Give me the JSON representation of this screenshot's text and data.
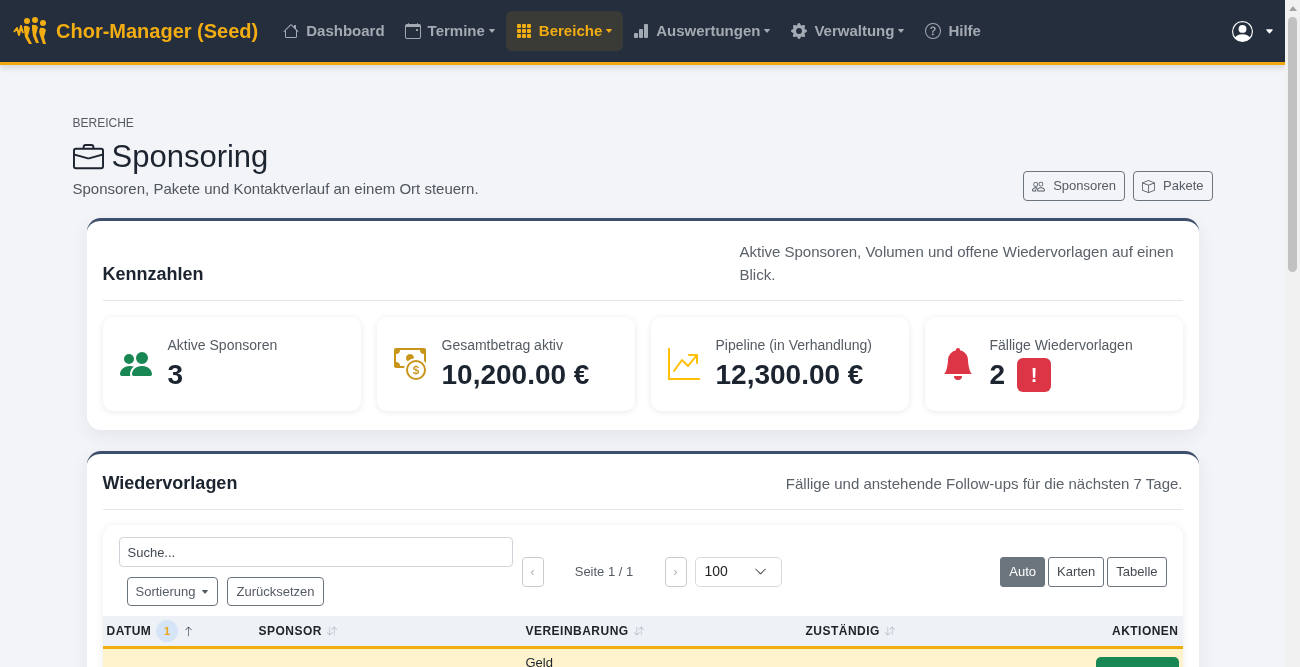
{
  "navbar": {
    "brand": "Chor-Manager (Seed)",
    "items": [
      {
        "label": "Dashboard",
        "has_menu": false,
        "selected": false
      },
      {
        "label": "Termine",
        "has_menu": true,
        "selected": false
      },
      {
        "label": "Bereiche",
        "has_menu": true,
        "selected": true
      },
      {
        "label": "Auswertungen",
        "has_menu": true,
        "selected": false
      },
      {
        "label": "Verwaltung",
        "has_menu": true,
        "selected": false
      },
      {
        "label": "Hilfe",
        "has_menu": false,
        "selected": false
      }
    ]
  },
  "header": {
    "breadcrumb": "BEREICHE",
    "title": "Sponsoring",
    "subtitle": "Sponsoren, Pakete und Kontaktverlauf an einem Ort steuern.",
    "actions": [
      "Sponsoren",
      "Pakete"
    ]
  },
  "kennzahlen": {
    "title": "Kennzahlen",
    "description": "Aktive Sponsoren, Volumen und offene Wiedervorlagen auf einen Blick.",
    "stats": [
      {
        "label": "Aktive Sponsoren",
        "value": "3",
        "color": "#198754"
      },
      {
        "label": "Gesamtbetrag aktiv",
        "value": "10,200.00 €",
        "color": "#c8951a"
      },
      {
        "label": "Pipeline (in Verhandlung)",
        "value": "12,300.00 €",
        "color": "#ffc107"
      },
      {
        "label": "Fällige Wiedervorlagen",
        "value": "2",
        "color": "#dc3545",
        "badge": "!"
      }
    ]
  },
  "wiedervorlagen": {
    "title": "Wiedervorlagen",
    "description": "Fällige und anstehende Follow-ups für die nächsten 7 Tage.",
    "search": {
      "placeholder": "Suche..."
    },
    "sort_button": "Sortierung",
    "reset_button": "Zurücksetzen",
    "pager": {
      "prev": {
        "label": "‹",
        "disabled": true
      },
      "label": "Seite 1 / 1",
      "next": {
        "label": "›",
        "disabled": true
      }
    },
    "page_size": "100",
    "views": [
      {
        "label": "Auto",
        "selected": true
      },
      {
        "label": "Karten",
        "selected": false
      },
      {
        "label": "Tabelle",
        "selected": false
      }
    ],
    "table": {
      "columns": [
        {
          "label": "DATUM",
          "sortable": true,
          "sort_rank": "1"
        },
        {
          "label": "SPONSOR",
          "sortable": true
        },
        {
          "label": "VEREINBARUNG",
          "sortable": true
        },
        {
          "label": "ZUSTÄNDIG",
          "sortable": true
        },
        {
          "label": "AKTIONEN",
          "sortable": false
        }
      ],
      "rows": [
        {
          "vereinbarung": "Geld",
          "highlighted": true
        }
      ]
    }
  }
}
